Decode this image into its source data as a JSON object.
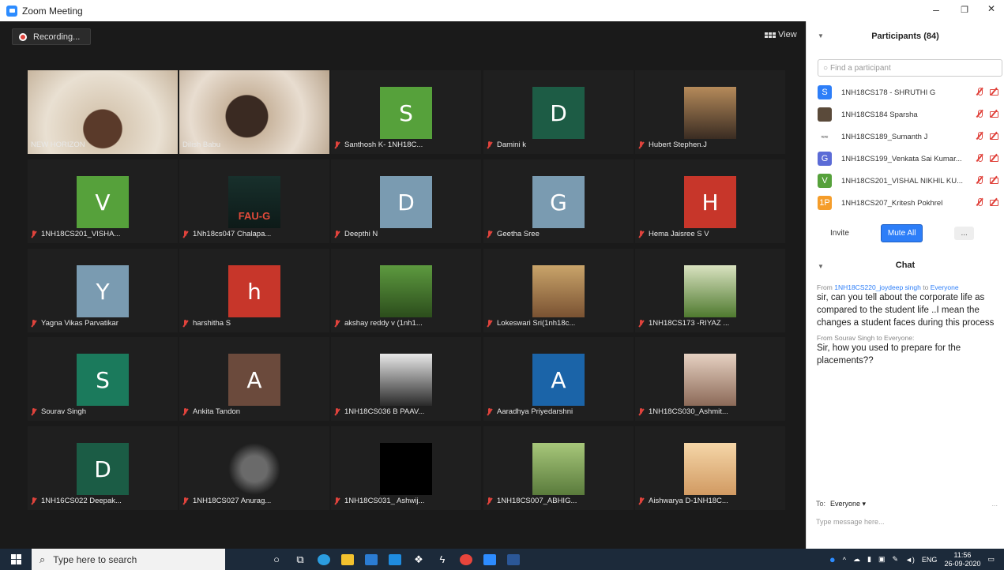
{
  "window": {
    "title": "Zoom Meeting",
    "minimize": "–",
    "restore": "❐",
    "close": "✕"
  },
  "stage": {
    "recording_label": "Recording...",
    "view_label": "View"
  },
  "tiles": [
    {
      "name": "NEW HORIZON",
      "type": "video",
      "muted": false
    },
    {
      "name": "Dilish Babu",
      "type": "video",
      "muted": false
    },
    {
      "name": "Santhosh K- 1NH18C...",
      "type": "avatar",
      "initial": "S",
      "color": "#56a13b",
      "muted": true
    },
    {
      "name": "Damini k",
      "type": "avatar",
      "initial": "D",
      "color": "#1d5c45",
      "muted": true
    },
    {
      "name": "Hubert Stephen.J",
      "type": "photo",
      "muted": true
    },
    {
      "name": "1NH18CS201_VISHA...",
      "type": "avatar",
      "initial": "V",
      "color": "#56a13b",
      "muted": true
    },
    {
      "name": "1Nh18cs047 Chalapa...",
      "type": "photo",
      "muted": true,
      "photo_text": "FAU-G"
    },
    {
      "name": "Deepthi N",
      "type": "avatar",
      "initial": "D",
      "color": "#7a9bb1",
      "muted": true
    },
    {
      "name": "Geetha Sree",
      "type": "avatar",
      "initial": "G",
      "color": "#7a9bb1",
      "muted": true
    },
    {
      "name": "Hema Jaisree S V",
      "type": "avatar",
      "initial": "H",
      "color": "#c7362a",
      "muted": true
    },
    {
      "name": "Yagna Vikas Parvatikar",
      "type": "avatar",
      "initial": "Y",
      "color": "#7a9bb1",
      "muted": true
    },
    {
      "name": "harshitha S",
      "type": "avatar",
      "initial": "h",
      "color": "#c7362a",
      "muted": true
    },
    {
      "name": "akshay reddy v (1nh1...",
      "type": "photo",
      "muted": true
    },
    {
      "name": "Lokeswari Sri(1nh18c...",
      "type": "photo",
      "muted": true
    },
    {
      "name": "1NH18CS173 -RIYAZ ...",
      "type": "photo",
      "muted": true
    },
    {
      "name": "Sourav Singh",
      "type": "avatar",
      "initial": "S",
      "color": "#1b7a5c",
      "muted": true
    },
    {
      "name": "Ankita Tandon",
      "type": "avatar",
      "initial": "A",
      "color": "#6b4a3c",
      "muted": true
    },
    {
      "name": "1NH18CS036 B PAAV...",
      "type": "photo",
      "muted": true
    },
    {
      "name": "Aaradhya Priyedarshni",
      "type": "avatar",
      "initial": "A",
      "color": "#1b64a8",
      "muted": true
    },
    {
      "name": "1NH18CS030_Ashmit...",
      "type": "photo",
      "muted": true
    },
    {
      "name": "1NH16CS022 Deepak...",
      "type": "avatar",
      "initial": "D",
      "color": "#1b5c45",
      "muted": true
    },
    {
      "name": "1NH18CS027 Anurag...",
      "type": "photo",
      "muted": true
    },
    {
      "name": "1NH18CS031_ Ashwij...",
      "type": "photo",
      "muted": true
    },
    {
      "name": "1NH18CS007_ABHIG...",
      "type": "photo",
      "muted": true
    },
    {
      "name": "Aishwarya D-1NH18C...",
      "type": "photo",
      "muted": true
    }
  ],
  "participants": {
    "title": "Participants (84)",
    "search_placeholder": "Find a participant",
    "list": [
      {
        "name": "1NH18CS178 - SHRUTHI G",
        "initial": "S",
        "color": "#2d7ef8"
      },
      {
        "name": "1NH18CS184 Sparsha",
        "initial": "",
        "color": "#5a4a3a"
      },
      {
        "name": "1NH18CS189_Sumanth J",
        "initial": "≈≈",
        "color": "#ffffff"
      },
      {
        "name": "1NH18CS199_Venkata Sai Kumar...",
        "initial": "G",
        "color": "#5b6bd6"
      },
      {
        "name": "1NH18CS201_VISHAL NIKHIL KU...",
        "initial": "V",
        "color": "#56a13b"
      },
      {
        "name": "1NH18CS207_Kritesh Pokhrel",
        "initial": "1P",
        "color": "#f59d2a"
      }
    ],
    "invite_label": "Invite",
    "mute_all_label": "Mute All",
    "more_label": "..."
  },
  "chat": {
    "title": "Chat",
    "messages": [
      {
        "from_prefix": "From",
        "sender": "1NH18CS220_joydeep singh",
        "to_prefix": "to",
        "to": "Everyone",
        "text": "sir, can you tell about the corporate life as compared to the student life ..I mean the changes a student faces during this process"
      },
      {
        "from_line": "From Sourav Singh to Everyone:",
        "text": "Sir, how you used to prepare for the placements??"
      }
    ],
    "to_label": "To:",
    "to_value": "Everyone ▾",
    "more": "...",
    "input_placeholder": "Type message here..."
  },
  "taskbar": {
    "search_placeholder": "Type here to search",
    "lang": "ENG",
    "time": "11:56",
    "date": "26-09-2020"
  }
}
